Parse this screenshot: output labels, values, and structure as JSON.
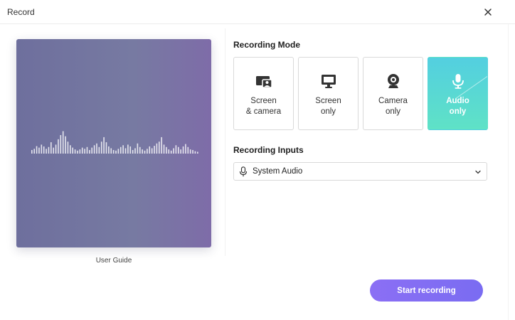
{
  "window": {
    "title": "Record"
  },
  "preview": {
    "caption": "User Guide",
    "waveform_levels": [
      0.12,
      0.16,
      0.25,
      0.2,
      0.3,
      0.24,
      0.16,
      0.22,
      0.38,
      0.2,
      0.3,
      0.48,
      0.62,
      0.75,
      0.58,
      0.4,
      0.28,
      0.2,
      0.14,
      0.1,
      0.14,
      0.2,
      0.16,
      0.22,
      0.12,
      0.2,
      0.28,
      0.34,
      0.22,
      0.4,
      0.55,
      0.38,
      0.24,
      0.18,
      0.12,
      0.1,
      0.16,
      0.22,
      0.28,
      0.18,
      0.3,
      0.24,
      0.12,
      0.18,
      0.34,
      0.22,
      0.14,
      0.1,
      0.16,
      0.24,
      0.18,
      0.26,
      0.34,
      0.4,
      0.55,
      0.3,
      0.22,
      0.14,
      0.1,
      0.18,
      0.28,
      0.22,
      0.14,
      0.24,
      0.32,
      0.22,
      0.14,
      0.12,
      0.08,
      0.06
    ]
  },
  "recording_mode": {
    "title": "Recording Mode",
    "options": [
      {
        "line1": "Screen",
        "line2": "& camera",
        "icon": "screen-camera-icon",
        "selected": false
      },
      {
        "line1": "Screen",
        "line2": "only",
        "icon": "monitor-icon",
        "selected": false
      },
      {
        "line1": "Camera",
        "line2": "only",
        "icon": "webcam-icon",
        "selected": false
      },
      {
        "line1": "Audio",
        "line2": "only",
        "icon": "microphone-icon",
        "selected": true
      }
    ]
  },
  "recording_inputs": {
    "title": "Recording Inputs",
    "selected": "System Audio",
    "icon": "microphone-icon"
  },
  "actions": {
    "start_label": "Start recording"
  },
  "colors": {
    "accent": "#7b6cf2",
    "active_mode": "#56d6d8",
    "preview_bg": "#7476a0"
  }
}
